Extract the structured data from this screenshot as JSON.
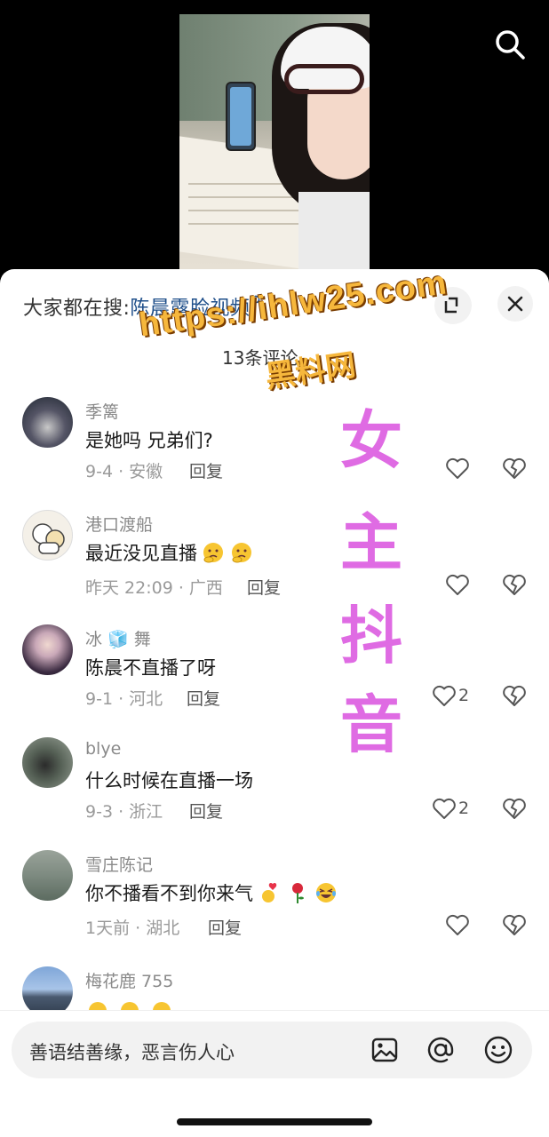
{
  "header": {
    "hot_search_prefix": "大家都在搜:",
    "hot_search_term": "陈晨露脸视频",
    "behind_text": "13条评论"
  },
  "comments": [
    {
      "name": "季篱",
      "text": "是她吗 兄弟们?",
      "meta": "9-4 · 安徽",
      "reply": "回复",
      "likes": ""
    },
    {
      "name": "港口渡船",
      "text": "最近没见直播",
      "meta": "昨天 22:09 · 广西",
      "reply": "回复",
      "likes": ""
    },
    {
      "name": "冰 🧊 舞",
      "text": "陈晨不直播了呀",
      "meta": "9-1 · 河北",
      "reply": "回复",
      "likes": "2"
    },
    {
      "name": "blye",
      "text": "什么时候在直播一场",
      "meta": "9-3 · 浙江",
      "reply": "回复",
      "likes": "2"
    },
    {
      "name": "雪庄陈记",
      "text": "你不播看不到你来气",
      "meta": "1天前 · 湖北",
      "reply": "回复",
      "likes": ""
    },
    {
      "name": "梅花鹿 755",
      "text": "",
      "meta": "",
      "reply": "",
      "likes": ""
    }
  ],
  "watermark": {
    "url": "https://ihlw25.com",
    "site": "黑料网",
    "vertical": [
      "女",
      "主",
      "抖",
      "音"
    ]
  },
  "input": {
    "placeholder": "善语结善缘，恶言伤人心"
  },
  "icons": {
    "search": "search-icon",
    "expand": "expand-icon",
    "close": "close-icon",
    "like": "heart-outline-icon",
    "dislike": "broken-heart-icon",
    "image": "image-icon",
    "mention": "at-icon",
    "emoji": "smiley-icon"
  },
  "colors": {
    "term_link": "#1f4f8a",
    "watermark_orange": "#f6b73c",
    "watermark_purple": "#df6be3"
  }
}
